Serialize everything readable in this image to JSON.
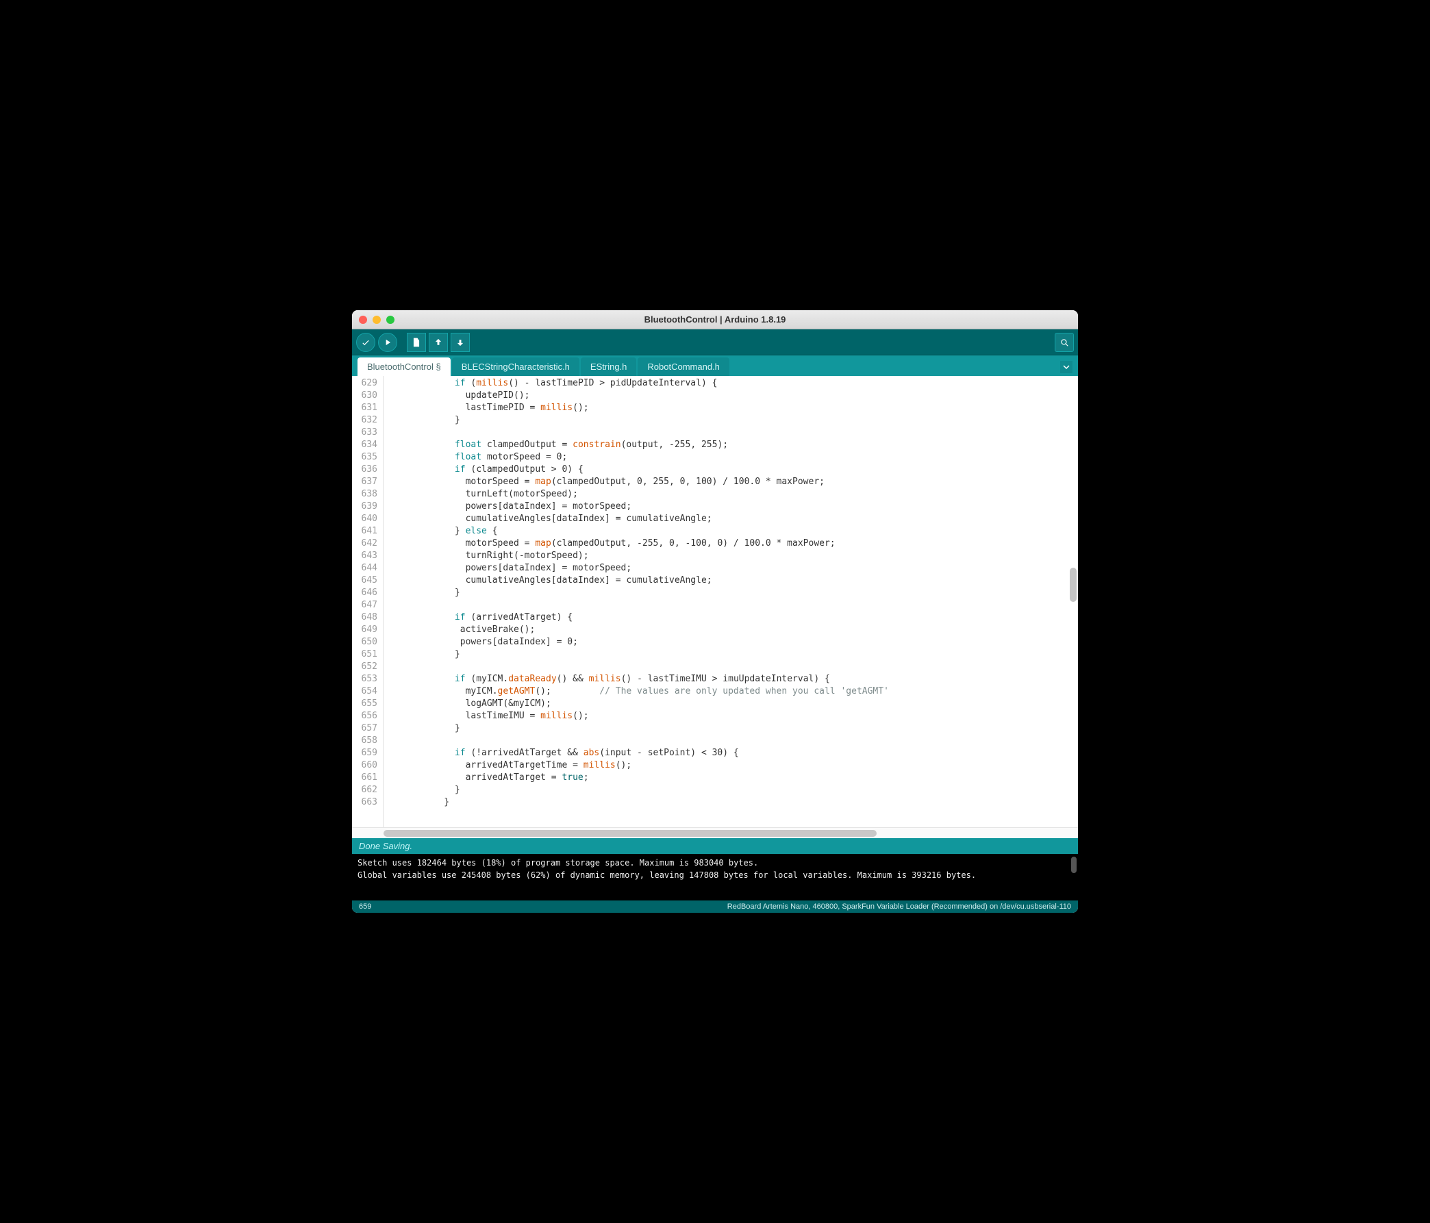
{
  "window": {
    "title": "BluetoothControl | Arduino 1.8.19"
  },
  "tabs": [
    {
      "label": "BluetoothControl §",
      "active": true
    },
    {
      "label": "BLECStringCharacteristic.h",
      "active": false
    },
    {
      "label": "EString.h",
      "active": false
    },
    {
      "label": "RobotCommand.h",
      "active": false
    }
  ],
  "editor": {
    "first_line": 629,
    "lines": [
      [
        [
          "",
          "            "
        ],
        [
          "kw",
          "if"
        ],
        [
          "",
          " ("
        ],
        [
          "fn",
          "millis"
        ],
        [
          "",
          "() - lastTimePID > pidUpdateInterval) {"
        ]
      ],
      [
        [
          "",
          "              updatePID();"
        ]
      ],
      [
        [
          "",
          "              lastTimePID = "
        ],
        [
          "fn",
          "millis"
        ],
        [
          "",
          "();"
        ]
      ],
      [
        [
          "",
          "            }"
        ]
      ],
      [
        [
          "",
          ""
        ]
      ],
      [
        [
          "",
          "            "
        ],
        [
          "kw",
          "float"
        ],
        [
          "",
          " clampedOutput = "
        ],
        [
          "fn",
          "constrain"
        ],
        [
          "",
          "(output, -255, 255);"
        ]
      ],
      [
        [
          "",
          "            "
        ],
        [
          "kw",
          "float"
        ],
        [
          "",
          " motorSpeed = 0;"
        ]
      ],
      [
        [
          "",
          "            "
        ],
        [
          "kw",
          "if"
        ],
        [
          "",
          " (clampedOutput > 0) {"
        ]
      ],
      [
        [
          "",
          "              motorSpeed = "
        ],
        [
          "fn",
          "map"
        ],
        [
          "",
          "(clampedOutput, 0, 255, 0, 100) / 100.0 * maxPower;"
        ]
      ],
      [
        [
          "",
          "              turnLeft(motorSpeed);"
        ]
      ],
      [
        [
          "",
          "              powers[dataIndex] = motorSpeed;"
        ]
      ],
      [
        [
          "",
          "              cumulativeAngles[dataIndex] = cumulativeAngle;"
        ]
      ],
      [
        [
          "",
          "            } "
        ],
        [
          "kw",
          "else"
        ],
        [
          "",
          " {"
        ]
      ],
      [
        [
          "",
          "              motorSpeed = "
        ],
        [
          "fn",
          "map"
        ],
        [
          "",
          "(clampedOutput, -255, 0, -100, 0) / 100.0 * maxPower;"
        ]
      ],
      [
        [
          "",
          "              turnRight(-motorSpeed);"
        ]
      ],
      [
        [
          "",
          "              powers[dataIndex] = motorSpeed;"
        ]
      ],
      [
        [
          "",
          "              cumulativeAngles[dataIndex] = cumulativeAngle;"
        ]
      ],
      [
        [
          "",
          "            }"
        ]
      ],
      [
        [
          "",
          ""
        ]
      ],
      [
        [
          "",
          "            "
        ],
        [
          "kw",
          "if"
        ],
        [
          "",
          " (arrivedAtTarget) {"
        ]
      ],
      [
        [
          "",
          "             activeBrake();"
        ]
      ],
      [
        [
          "",
          "             powers[dataIndex] = 0;"
        ]
      ],
      [
        [
          "",
          "            }"
        ]
      ],
      [
        [
          "",
          ""
        ]
      ],
      [
        [
          "",
          "            "
        ],
        [
          "kw",
          "if"
        ],
        [
          "",
          " (myICM."
        ],
        [
          "fn",
          "dataReady"
        ],
        [
          "",
          "() && "
        ],
        [
          "fn",
          "millis"
        ],
        [
          "",
          "() - lastTimeIMU > imuUpdateInterval) {"
        ]
      ],
      [
        [
          "",
          "              myICM."
        ],
        [
          "fn",
          "getAGMT"
        ],
        [
          "",
          "();         "
        ],
        [
          "cm",
          "// The values are only updated when you call 'getAGMT'"
        ]
      ],
      [
        [
          "",
          "              logAGMT(&myICM);"
        ]
      ],
      [
        [
          "",
          "              lastTimeIMU = "
        ],
        [
          "fn",
          "millis"
        ],
        [
          "",
          "();"
        ]
      ],
      [
        [
          "",
          "            }"
        ]
      ],
      [
        [
          "",
          ""
        ]
      ],
      [
        [
          "",
          "            "
        ],
        [
          "kw",
          "if"
        ],
        [
          "",
          " (!arrivedAtTarget && "
        ],
        [
          "fn",
          "abs"
        ],
        [
          "",
          "(input - setPoint) < 30) {"
        ]
      ],
      [
        [
          "",
          "              arrivedAtTargetTime = "
        ],
        [
          "fn",
          "millis"
        ],
        [
          "",
          "();"
        ]
      ],
      [
        [
          "",
          "              arrivedAtTarget = "
        ],
        [
          "lit",
          "true"
        ],
        [
          "",
          ";"
        ]
      ],
      [
        [
          "",
          "            }"
        ]
      ],
      [
        [
          "",
          "          }"
        ]
      ]
    ]
  },
  "status": {
    "message": "Done Saving."
  },
  "console": {
    "lines": [
      "Sketch uses 182464 bytes (18%) of program storage space. Maximum is 983040 bytes.",
      "Global variables use 245408 bytes (62%) of dynamic memory, leaving 147808 bytes for local variables. Maximum is 393216 bytes."
    ]
  },
  "footer": {
    "line_number": "659",
    "board_info": "RedBoard Artemis Nano, 460800, SparkFun Variable Loader (Recommended) on /dev/cu.usbserial-110"
  }
}
